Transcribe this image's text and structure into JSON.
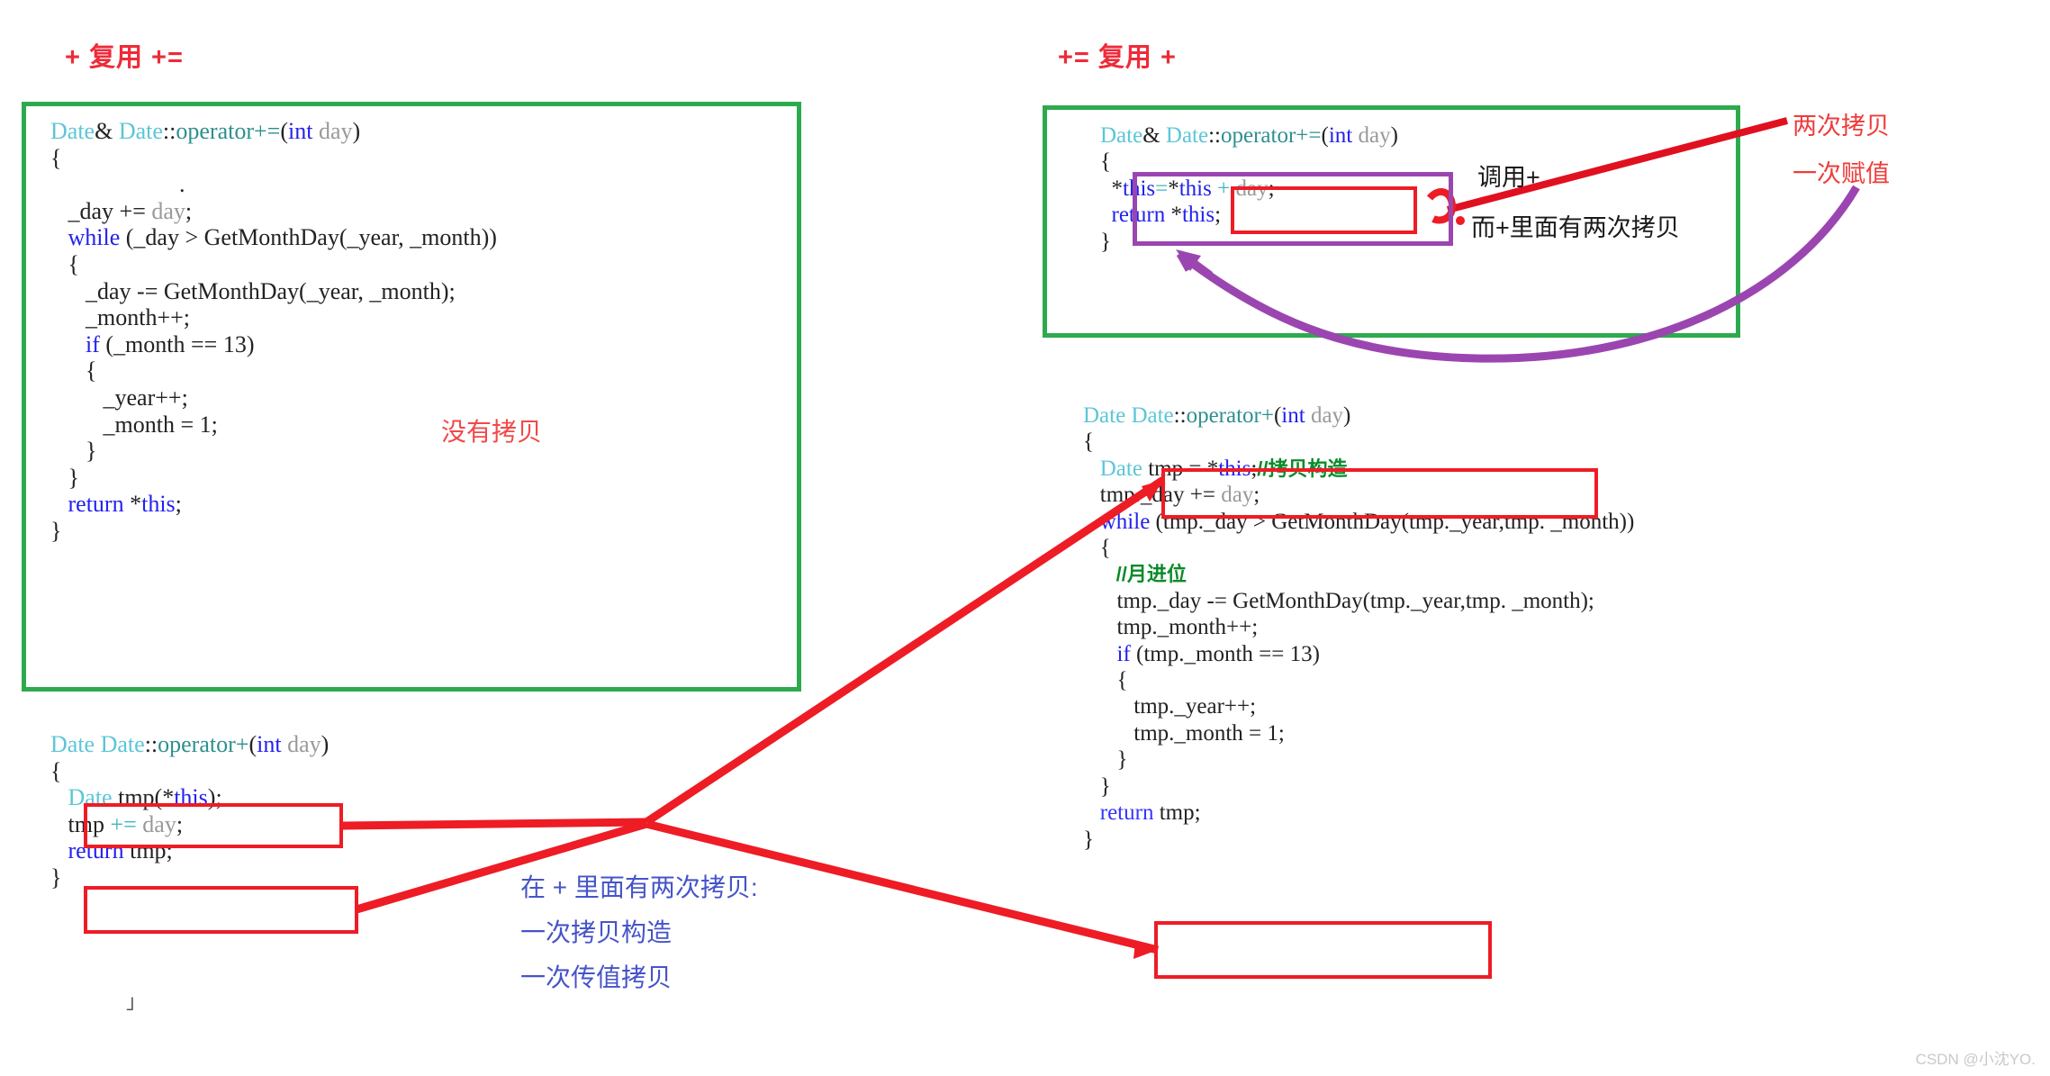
{
  "left": {
    "title": "+ 复用 +=",
    "code_top": [
      "Date& Date::operator+=(int day)",
      "{",
      "",
      "    _day += day;",
      "    while (_day > GetMonthDay(_year, _month))",
      "    {",
      "        _day -= GetMonthDay(_year, _month);",
      "        _month++;",
      "        if (_month == 13)",
      "        {",
      "            _year++;",
      "            _month = 1;",
      "        }",
      "    }",
      "    return *this;",
      "}"
    ],
    "code_bottom": [
      "Date Date::operator+(int day)",
      "{",
      "    Date tmp(*this);",
      "    tmp += day;",
      "    return tmp;",
      "}"
    ],
    "note_no_copy": "没有拷贝",
    "stray_mark": "」"
  },
  "right": {
    "title": "+= 复用 +",
    "code_top": [
      "Date& Date::operator+=(int day)",
      "{",
      "    *this=*this + day;",
      "    return *this;",
      "}"
    ],
    "code_bottom": [
      "Date Date::operator+(int day)",
      "{",
      "    Date tmp = *this;//拷贝构造",
      "    tmp._day += day;",
      "    while (tmp._day > GetMonthDay(tmp._year,tmp. _month))",
      "    {",
      "        //月进位",
      "        tmp._day -= GetMonthDay(tmp._year,tmp. _month);",
      "        tmp._month++;",
      "        if (tmp._month == 13)",
      "        {",
      "            tmp._year++;",
      "            tmp._month = 1;",
      "        }",
      "    }",
      "    return tmp;",
      "}"
    ],
    "comment_copy_ctor": "//拷贝构造",
    "comment_month_carry": "//月进位"
  },
  "annotations": {
    "two_copies": "两次拷贝",
    "one_assignment": "一次赋值",
    "call_plus": "调用+",
    "plus_has_two_copies": "而+里面有两次拷贝",
    "blue_line1": "在 + 里面有两次拷贝:",
    "blue_line2": "一次拷贝构造",
    "blue_line3": "一次传值拷贝"
  },
  "watermark": "CSDN @小沈YO.",
  "colors": {
    "title_red": "#ee2b39",
    "frame_green": "#2eaa4e",
    "highlight_red": "#ee1c25",
    "highlight_purple": "#9b46b0",
    "annotation_blue": "#4654c9",
    "comment_green": "#0b8a2a",
    "type_cyan": "#5cc6d6",
    "keyword_blue": "#2222ee"
  }
}
